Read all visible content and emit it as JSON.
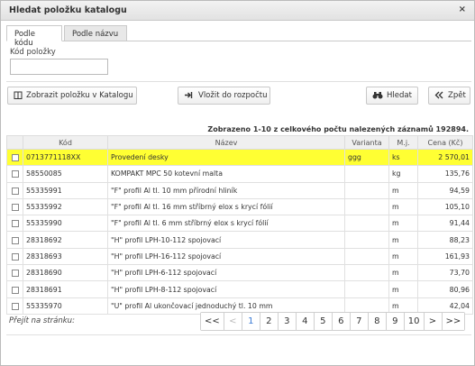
{
  "dialog": {
    "title": "Hledat položku katalogu",
    "close_glyph": "×"
  },
  "tabs": [
    {
      "label": "Podle kódu"
    },
    {
      "label": "Podle názvu"
    }
  ],
  "form": {
    "code_label": "Kód položky",
    "code_value": ""
  },
  "buttons": {
    "show_in_catalog": "Zobrazit položku v Katalogu",
    "insert_budget": "Vložit do rozpočtu",
    "search": "Hledat",
    "back": "Zpět"
  },
  "icons": {
    "show_in_catalog": "book-icon",
    "insert_budget": "arrow-in-icon",
    "search": "binoculars-icon",
    "back": "double-chevron-left-icon"
  },
  "summary": "Zobrazeno 1-10 z celkového počtu nalezených záznamů 192894.",
  "table": {
    "headers": [
      "",
      "Kód",
      "Název",
      "Varianta",
      "M.j.",
      "Cena (Kč)"
    ],
    "rows": [
      {
        "code": "0713771118XX",
        "name": "Provedení desky",
        "variant": "ggg",
        "unit": "ks",
        "price": "2 570,01",
        "highlighted": true
      },
      {
        "code": "58550085",
        "name": "KOMPAKT MPC 50 kotevní malta",
        "variant": "",
        "unit": "kg",
        "price": "135,76"
      },
      {
        "code": "55335991",
        "name": "\"F\" profil Al tl. 10 mm přírodní hliník",
        "variant": "",
        "unit": "m",
        "price": "94,59"
      },
      {
        "code": "55335992",
        "name": "\"F\" profil Al tl. 16 mm stříbrný elox s krycí fólií",
        "variant": "",
        "unit": "m",
        "price": "105,10"
      },
      {
        "code": "55335990",
        "name": "\"F\" profil Al tl. 6 mm stříbrný elox s krycí fólií",
        "variant": "",
        "unit": "m",
        "price": "91,44"
      },
      {
        "code": "28318692",
        "name": "\"H\" profil LPH-10-112 spojovací",
        "variant": "",
        "unit": "m",
        "price": "88,23"
      },
      {
        "code": "28318693",
        "name": "\"H\" profil LPH-16-112 spojovací",
        "variant": "",
        "unit": "m",
        "price": "161,93"
      },
      {
        "code": "28318690",
        "name": "\"H\" profil LPH-6-112 spojovací",
        "variant": "",
        "unit": "m",
        "price": "73,70"
      },
      {
        "code": "28318691",
        "name": "\"H\" profil LPH-8-112 spojovací",
        "variant": "",
        "unit": "m",
        "price": "80,96"
      },
      {
        "code": "55335970",
        "name": "\"U\" profil Al ukončovací jednoduchý tl. 10 mm",
        "variant": "",
        "unit": "m",
        "price": "42,04"
      }
    ]
  },
  "pager": {
    "goto_label": "Přejít na stránku:",
    "first": "<<",
    "prev": "<",
    "pages": [
      "1",
      "2",
      "3",
      "4",
      "5",
      "6",
      "7",
      "8",
      "9",
      "10"
    ],
    "next": ">",
    "last": ">>",
    "current_page": "1"
  },
  "colors": {
    "highlight": "#ffff33",
    "current_page": "#3a7bd5"
  }
}
